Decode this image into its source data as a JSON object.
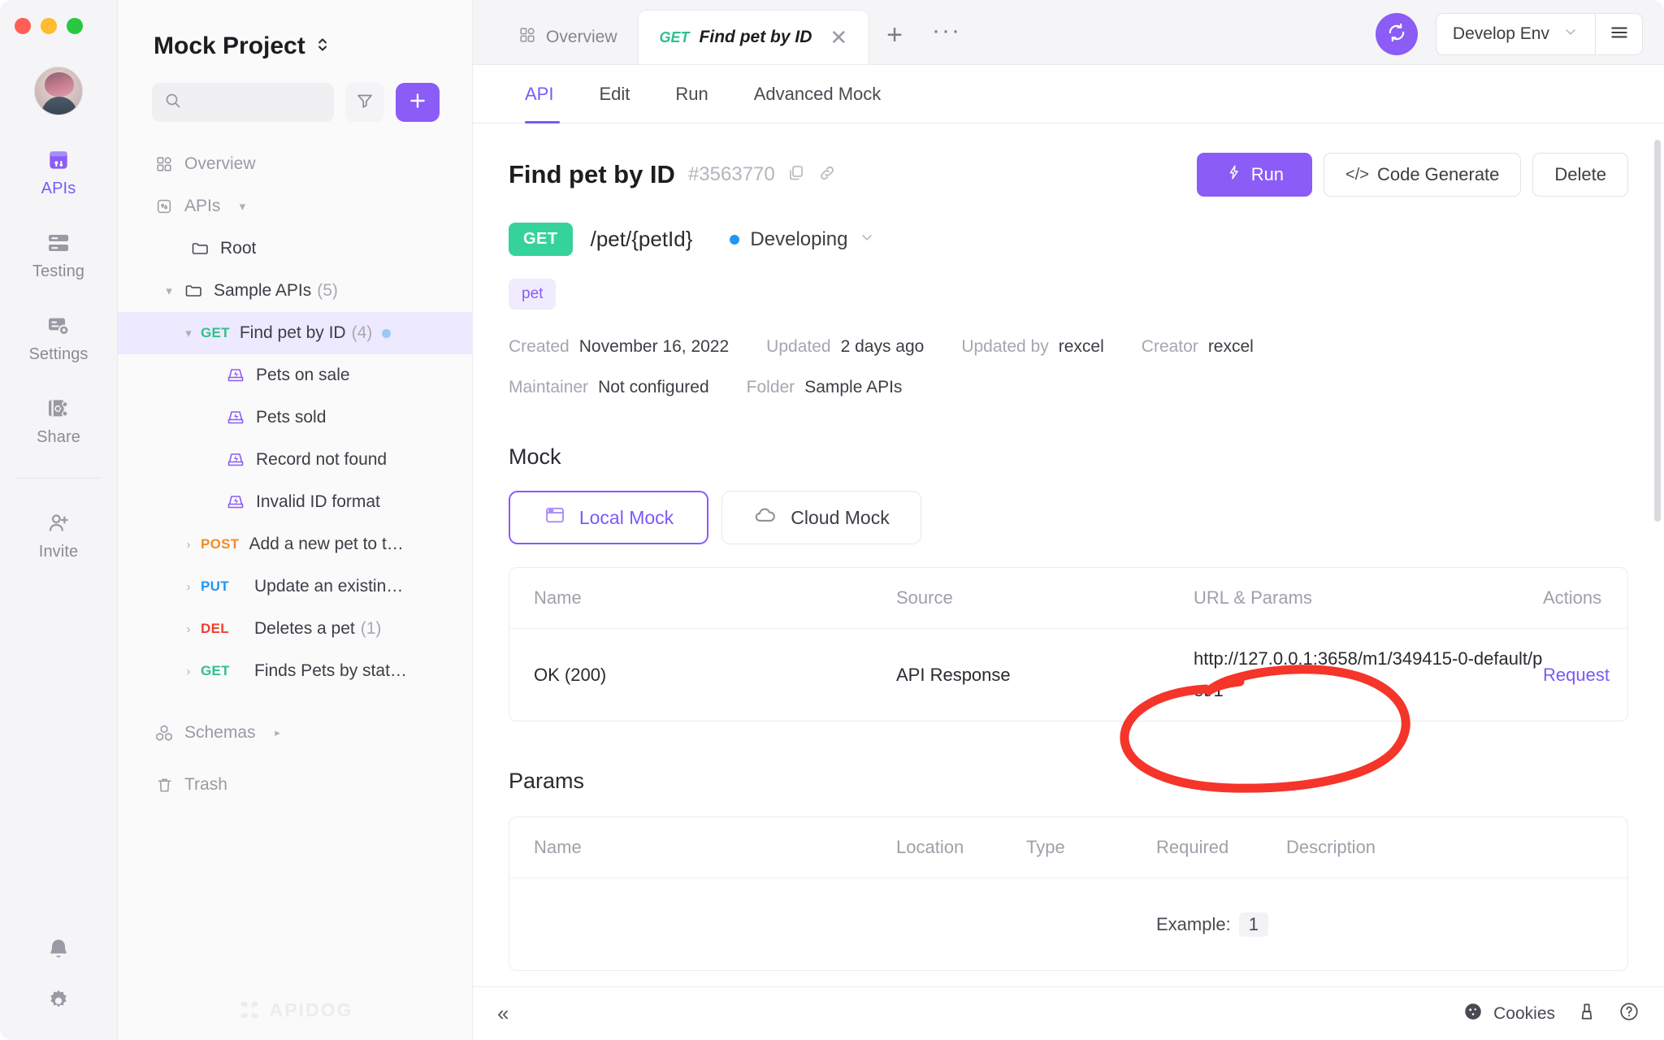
{
  "window": {
    "traffic_lights": [
      "close",
      "minimize",
      "zoom"
    ]
  },
  "rail": {
    "items": [
      {
        "label": "APIs",
        "icon": "apis-icon",
        "active": true
      },
      {
        "label": "Testing",
        "icon": "testing-icon",
        "active": false
      },
      {
        "label": "Settings",
        "icon": "settings-icon",
        "active": false
      },
      {
        "label": "Share",
        "icon": "share-icon",
        "active": false
      },
      {
        "label": "Invite",
        "icon": "invite-icon",
        "active": false
      }
    ],
    "bottom": [
      {
        "label": "Notifications",
        "icon": "bell-icon"
      },
      {
        "label": "Preferences",
        "icon": "gear-icon"
      }
    ]
  },
  "sidebar": {
    "project_name": "Mock Project",
    "search_placeholder": "",
    "search_value": "",
    "filter_label": "Filter",
    "add_label": "+",
    "watermark": "APIDOG",
    "tree": [
      {
        "label": "Overview",
        "icon": "grid-icon",
        "type": "nav",
        "indent": 0,
        "muted": true
      },
      {
        "label": "APIs",
        "icon": "api-icon",
        "type": "nav",
        "indent": 0,
        "muted": true,
        "caret": "down-small"
      },
      {
        "label": "Root",
        "icon": "folder-icon",
        "type": "folder",
        "indent": 1
      },
      {
        "label": "Sample APIs",
        "icon": "folder-icon",
        "type": "folder",
        "indent": 2,
        "count": "(5)",
        "caret": "down"
      },
      {
        "label": "Find pet by ID",
        "method": "GET",
        "type": "api",
        "indent": 3,
        "count": "(4)",
        "caret": "down",
        "selected": true,
        "dot": true
      },
      {
        "label": "Pets on sale",
        "icon": "mock-icon",
        "type": "case",
        "indent": 4
      },
      {
        "label": "Pets sold",
        "icon": "mock-icon",
        "type": "case",
        "indent": 4
      },
      {
        "label": "Record not found",
        "icon": "mock-icon",
        "type": "case",
        "indent": 4
      },
      {
        "label": "Invalid ID format",
        "icon": "mock-icon",
        "type": "case",
        "indent": 4
      },
      {
        "label": "Add a new pet to t…",
        "method": "POST",
        "type": "api",
        "indent": 3,
        "caret": "right"
      },
      {
        "label": "Update an existin…",
        "method": "PUT",
        "type": "api",
        "indent": 3,
        "caret": "right"
      },
      {
        "label": "Deletes a pet",
        "method": "DEL",
        "type": "api",
        "indent": 3,
        "count": "(1)",
        "caret": "right"
      },
      {
        "label": "Finds Pets by stat…",
        "method": "GET",
        "type": "api",
        "indent": 3,
        "caret": "right"
      },
      {
        "label": "Schemas",
        "icon": "schemas-icon",
        "type": "nav",
        "indent": 0,
        "muted": true,
        "caret": "right-small"
      },
      {
        "label": "Trash",
        "icon": "trash-icon",
        "type": "nav",
        "indent": 0,
        "muted": true
      }
    ]
  },
  "tabbar": {
    "tabs": [
      {
        "label": "Overview",
        "icon": "grid-icon",
        "active": false,
        "closable": false
      },
      {
        "label": "Find pet by ID",
        "method": "GET",
        "active": true,
        "closable": true
      }
    ],
    "new_tab_label": "+",
    "more_label": "···",
    "sync_label": "Sync",
    "environment": "Develop Env",
    "menu_label": "Menu"
  },
  "subtabs": [
    {
      "label": "API",
      "active": true
    },
    {
      "label": "Edit",
      "active": false
    },
    {
      "label": "Run",
      "active": false
    },
    {
      "label": "Advanced Mock",
      "active": false
    }
  ],
  "api": {
    "title": "Find pet by ID",
    "id": "#3563770",
    "copy_icon": "copy-icon",
    "link_icon": "link-icon",
    "method": "GET",
    "path": "/pet/{petId}",
    "status": "Developing",
    "status_color": "#2196f3",
    "tags": [
      "pet"
    ],
    "actions": {
      "run": "Run",
      "code_generate": "Code Generate",
      "delete": "Delete"
    },
    "meta": [
      {
        "key": "Created",
        "value": "November 16, 2022"
      },
      {
        "key": "Updated",
        "value": "2 days ago"
      },
      {
        "key": "Updated by",
        "value": "rexcel"
      },
      {
        "key": "Creator",
        "value": "rexcel"
      }
    ],
    "meta2": [
      {
        "key": "Maintainer",
        "value": "Not configured"
      },
      {
        "key": "Folder",
        "value": "Sample APIs"
      }
    ]
  },
  "mock": {
    "section_title": "Mock",
    "segments": [
      {
        "label": "Local Mock",
        "icon": "window-icon",
        "active": true
      },
      {
        "label": "Cloud Mock",
        "icon": "cloud-icon",
        "active": false
      }
    ],
    "columns": [
      "Name",
      "Source",
      "URL & Params",
      "Actions"
    ],
    "rows": [
      {
        "name": "OK (200)",
        "source": "API Response",
        "url": "http://127.0.0.1:3658/m1/349415-0-default/pet/1",
        "action": "Request"
      }
    ]
  },
  "params": {
    "section_title": "Params",
    "columns": [
      "Name",
      "Location",
      "Type",
      "Required",
      "Description"
    ],
    "rows": [
      {
        "example_label": "Example:",
        "example_value": "1"
      }
    ]
  },
  "footer": {
    "collapse_label": "«",
    "cookies_label": "Cookies",
    "cleanup_icon": "broom-icon",
    "help_icon": "help-icon"
  },
  "annotation": {
    "type": "hand-drawn-circle",
    "color": "#f5342a",
    "targets": "mock url cell"
  }
}
